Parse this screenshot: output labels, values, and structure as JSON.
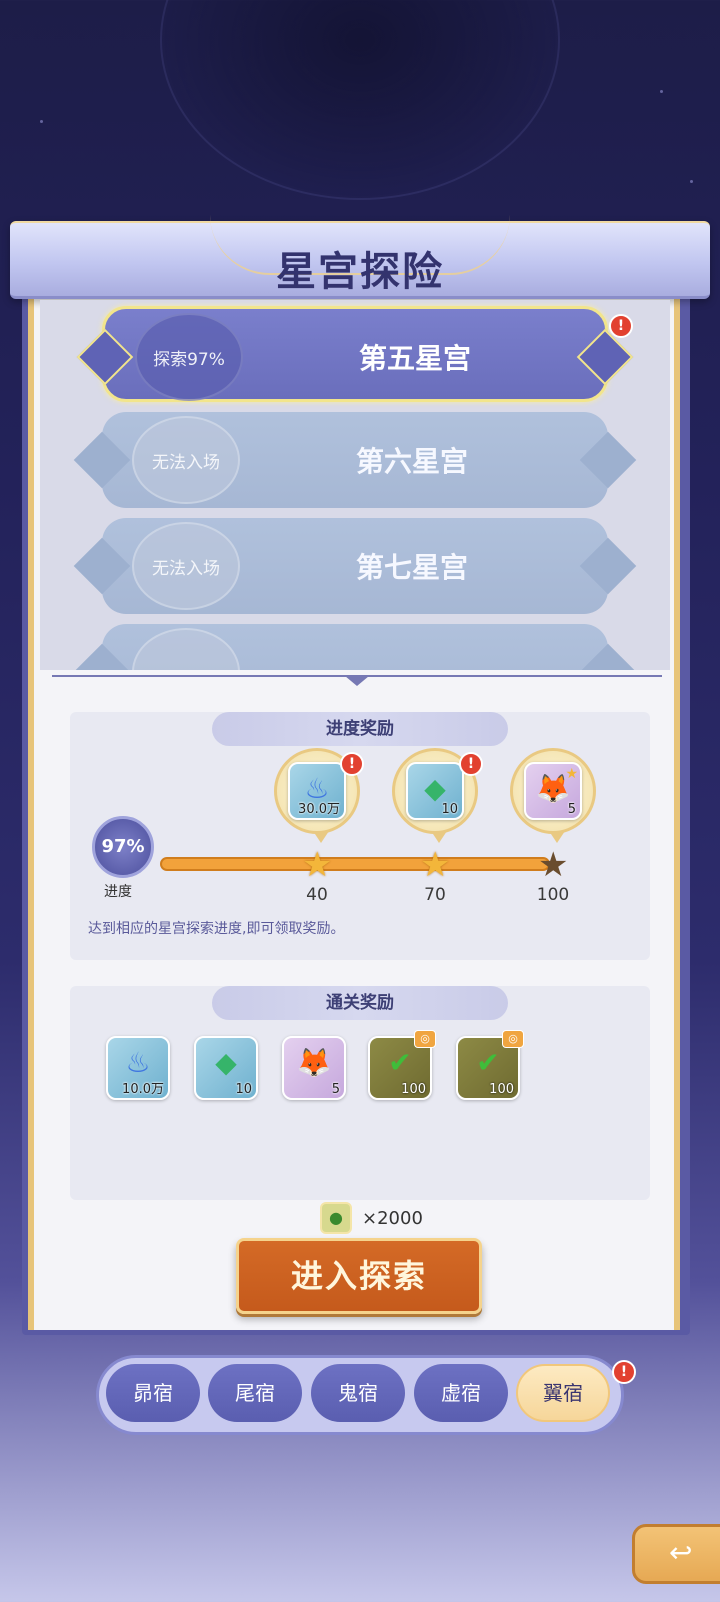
{
  "title": "星宫探险",
  "palaces": [
    {
      "status": "探索97%",
      "name": "第五星宫",
      "locked": false,
      "alert": true
    },
    {
      "status": "无法入场",
      "name": "第六星宫",
      "locked": true,
      "alert": false
    },
    {
      "status": "无法入场",
      "name": "第七星宫",
      "locked": true,
      "alert": false
    }
  ],
  "progress_rewards": {
    "header": "进度奖励",
    "progress_value": "97%",
    "progress_label": "进度",
    "progress_fraction": 0.97,
    "milestones": [
      {
        "threshold": "40",
        "reward_icon": "blue-flame-icon",
        "qty": "30.0万",
        "reached": true,
        "alert": true
      },
      {
        "threshold": "70",
        "reward_icon": "green-gem-icon",
        "qty": "10",
        "reached": true,
        "alert": true
      },
      {
        "threshold": "100",
        "reward_icon": "fox-character-icon",
        "qty": "5",
        "reached": false,
        "alert": false
      }
    ],
    "description": "达到相应的星宫探索进度,即可领取奖励。"
  },
  "clear_rewards": {
    "header": "通关奖励",
    "items": [
      {
        "icon": "blue-flame-icon",
        "qty": "10.0万"
      },
      {
        "icon": "green-gem-icon",
        "qty": "10"
      },
      {
        "icon": "fox-character-icon",
        "qty": "5"
      },
      {
        "icon": "check-icon",
        "qty": "100"
      },
      {
        "icon": "check-icon",
        "qty": "100"
      }
    ]
  },
  "cost": {
    "icon": "ticket-icon",
    "amount": "×2000"
  },
  "enter_button": "进入探索",
  "tabs": [
    {
      "label": "昴宿",
      "selected": false
    },
    {
      "label": "尾宿",
      "selected": false
    },
    {
      "label": "鬼宿",
      "selected": false
    },
    {
      "label": "虚宿",
      "selected": false
    },
    {
      "label": "翼宿",
      "selected": true
    }
  ],
  "alert_glyph": "!",
  "colors": {
    "accent": "#f2e58c",
    "button": "#c55a1c",
    "panel": "#5a5aa4",
    "alert": "#e24130"
  }
}
